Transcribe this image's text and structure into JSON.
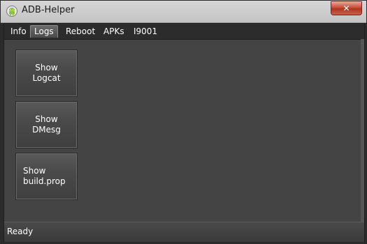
{
  "window": {
    "title": "ADB-Helper",
    "close_label": "✕"
  },
  "tabs": [
    {
      "label": "Info",
      "active": false
    },
    {
      "label": "Logs",
      "active": true
    },
    {
      "label": "Reboot",
      "active": false
    },
    {
      "label": "APKs",
      "active": false
    },
    {
      "label": "I9001",
      "active": false
    }
  ],
  "buttons": [
    {
      "label": "Show Logcat"
    },
    {
      "label": "Show DMesg"
    },
    {
      "label": "Show build.prop"
    }
  ],
  "status": {
    "text": "Ready"
  },
  "icons": {
    "app": "android-icon",
    "close": "close-icon"
  }
}
